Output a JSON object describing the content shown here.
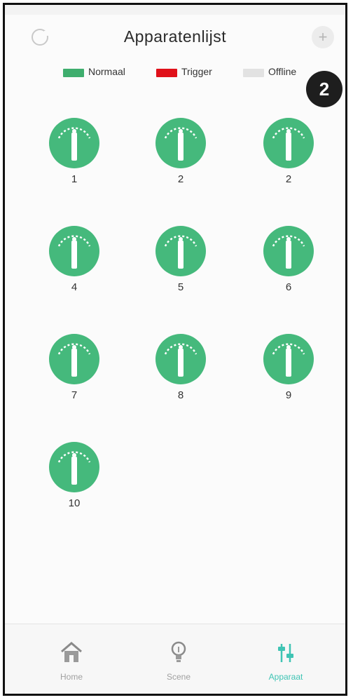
{
  "header": {
    "title": "Apparatenlijst",
    "add_icon": "plus-icon",
    "left_icon": "refresh-icon"
  },
  "legend": [
    {
      "label": "Normaal",
      "color": "#3fae6e"
    },
    {
      "label": "Trigger",
      "color": "#e0111a"
    },
    {
      "label": "Offline",
      "color": "#e2e2e2"
    }
  ],
  "badge": {
    "text": "2"
  },
  "colors": {
    "device_normal": "#45b97c",
    "accent": "#3fc4b4",
    "nav_inactive": "#a0a0a0"
  },
  "devices": [
    {
      "label": "1",
      "status": "Normaal",
      "icon": "gauge-sensor-icon"
    },
    {
      "label": "2",
      "status": "Normaal",
      "icon": "gauge-sensor-icon"
    },
    {
      "label": "2",
      "status": "Normaal",
      "icon": "gauge-sensor-icon"
    },
    {
      "label": "4",
      "status": "Normaal",
      "icon": "gauge-sensor-icon"
    },
    {
      "label": "5",
      "status": "Normaal",
      "icon": "gauge-sensor-icon"
    },
    {
      "label": "6",
      "status": "Normaal",
      "icon": "gauge-sensor-icon"
    },
    {
      "label": "7",
      "status": "Normaal",
      "icon": "gauge-sensor-icon"
    },
    {
      "label": "8",
      "status": "Normaal",
      "icon": "gauge-sensor-icon"
    },
    {
      "label": "9",
      "status": "Normaal",
      "icon": "gauge-sensor-icon"
    },
    {
      "label": "10",
      "status": "Normaal",
      "icon": "gauge-sensor-icon"
    }
  ],
  "nav": {
    "items": [
      {
        "label": "Home",
        "icon": "home-icon",
        "active": false
      },
      {
        "label": "Scene",
        "icon": "lightbulb-icon",
        "active": false
      },
      {
        "label": "Apparaat",
        "icon": "device-sliders-icon",
        "active": true
      }
    ]
  }
}
